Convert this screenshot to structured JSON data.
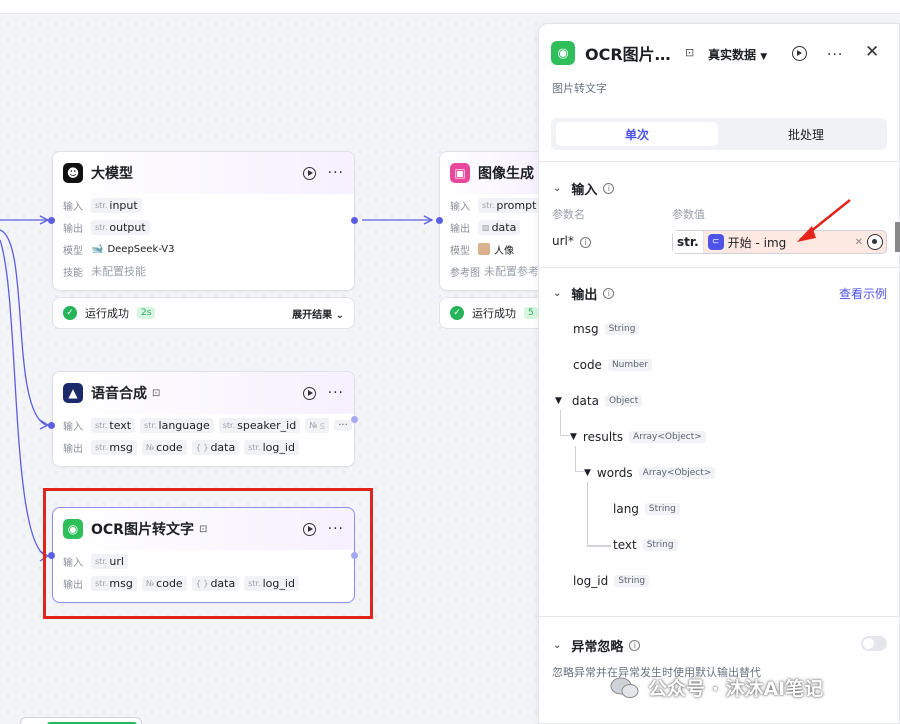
{
  "canvas": {
    "nodes": {
      "llm": {
        "title": "大模型",
        "in_label": "输入",
        "out_label": "输出",
        "model_label": "模型",
        "skills_label": "技能",
        "input": {
          "type": "str.",
          "name": "input"
        },
        "output": {
          "type": "str.",
          "name": "output"
        },
        "model": "DeepSeek-V3",
        "skills": "未配置技能"
      },
      "llm_status": {
        "text": "运行成功",
        "time": "2s",
        "expand": "展开结果"
      },
      "image_gen": {
        "title": "图像生成",
        "in_label": "输入",
        "out_label": "输出",
        "model_label": "模型",
        "ref_label": "参考图",
        "input": {
          "type": "str.",
          "name": "prompt"
        },
        "output": {
          "type": "▨",
          "name": "data"
        },
        "model": "人像",
        "ref": "未配置参考"
      },
      "image_status": {
        "text": "运行成功",
        "time": "5"
      },
      "tts": {
        "title": "语音合成",
        "in_label": "输入",
        "out_label": "输出",
        "inputs": [
          {
            "type": "str.",
            "name": "text"
          },
          {
            "type": "str.",
            "name": "language"
          },
          {
            "type": "str.",
            "name": "speaker_id"
          },
          {
            "type": "№",
            "name": "s"
          }
        ],
        "outputs": [
          {
            "type": "str.",
            "name": "msg"
          },
          {
            "type": "№",
            "name": "code"
          },
          {
            "type": "{ }",
            "name": "data"
          },
          {
            "type": "str.",
            "name": "log_id"
          }
        ]
      },
      "ocr": {
        "title": "OCR图片转文字",
        "in_label": "输入",
        "out_label": "输出",
        "inputs": [
          {
            "type": "str.",
            "name": "url"
          }
        ],
        "outputs": [
          {
            "type": "str.",
            "name": "msg"
          },
          {
            "type": "№",
            "name": "code"
          },
          {
            "type": "{ }",
            "name": "data"
          },
          {
            "type": "str.",
            "name": "log_id"
          }
        ]
      }
    }
  },
  "panel": {
    "title": "OCR图片…",
    "data_mode": "真实数据",
    "description": "图片转文字",
    "tabs": {
      "single": "单次",
      "batch": "批处理"
    },
    "input": {
      "heading": "输入",
      "col_param": "参数名",
      "col_value": "参数值",
      "param": "url*",
      "value_type": "str.",
      "value_ref": "开始 - img"
    },
    "output": {
      "heading": "输出",
      "link": "查看示例",
      "fields": [
        {
          "name": "msg",
          "type": "String"
        },
        {
          "name": "code",
          "type": "Number"
        },
        {
          "name": "data",
          "type": "Object"
        },
        {
          "name": "results",
          "type": "Array<Object>"
        },
        {
          "name": "words",
          "type": "Array<Object>"
        },
        {
          "name": "lang",
          "type": "String"
        },
        {
          "name": "text",
          "type": "String"
        },
        {
          "name": "log_id",
          "type": "String"
        }
      ]
    },
    "exception": {
      "heading": "异常忽略",
      "note": "忽略异常并在异常发生时使用默认输出替代"
    }
  },
  "watermark": "公众号 · 沐沐AI笔记",
  "colors": {
    "accent": "#4d53e8",
    "success": "#26b35a",
    "highlight": "#e3241b"
  }
}
